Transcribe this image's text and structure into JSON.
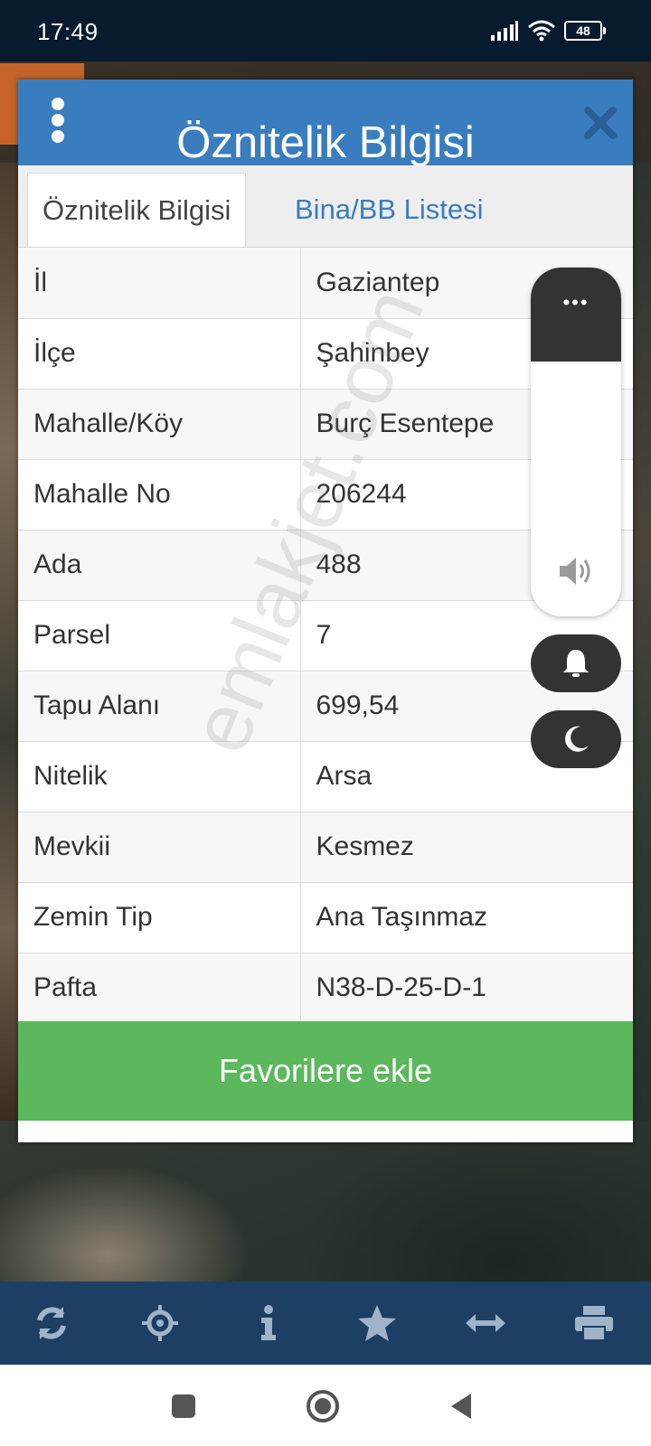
{
  "status_bar": {
    "time": "17:49",
    "battery": "48"
  },
  "dialog": {
    "title": "Öznitelik Bilgisi",
    "tabs": [
      {
        "label": "Öznitelik Bilgisi",
        "active": true
      },
      {
        "label": "Bina/BB Listesi",
        "active": false
      }
    ],
    "rows": [
      {
        "key": "İl",
        "value": "Gaziantep"
      },
      {
        "key": "İlçe",
        "value": "Şahinbey"
      },
      {
        "key": "Mahalle/Köy",
        "value": "Burç Esentepe"
      },
      {
        "key": "Mahalle No",
        "value": "206244"
      },
      {
        "key": "Ada",
        "value": "488"
      },
      {
        "key": "Parsel",
        "value": "7"
      },
      {
        "key": "Tapu Alanı",
        "value": "699,54"
      },
      {
        "key": "Nitelik",
        "value": "Arsa"
      },
      {
        "key": "Mevkii",
        "value": "Kesmez"
      },
      {
        "key": "Zemin Tip",
        "value": "Ana Taşınmaz"
      },
      {
        "key": "Pafta",
        "value": "N38-D-25-D-1"
      }
    ],
    "favorite_button": "Favorilere ekle"
  },
  "watermark": "emlakjet.com",
  "volume_overlay": {
    "menu_label": "•••",
    "icons": [
      "speaker-icon",
      "bell-icon",
      "moon-icon"
    ]
  },
  "toolbar": {
    "icons": [
      "refresh-icon",
      "locate-icon",
      "info-icon",
      "star-icon",
      "measure-icon",
      "print-icon"
    ]
  },
  "navbar": {
    "icons": [
      "recents-icon",
      "home-icon",
      "back-icon"
    ]
  },
  "colors": {
    "header_blue": "#3a7dbf",
    "button_green": "#5cb85c",
    "toolbar_navy": "#1d3f63",
    "status_bar": "#071a2e"
  }
}
